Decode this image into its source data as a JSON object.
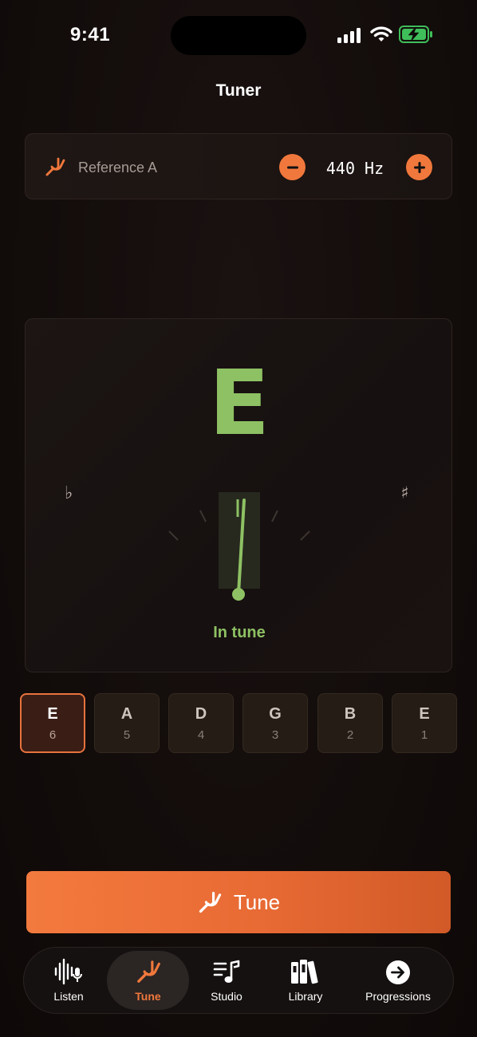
{
  "status_bar": {
    "time": "9:41"
  },
  "header": {
    "title": "Tuner"
  },
  "reference": {
    "label": "Reference A",
    "value": "440 Hz"
  },
  "tuner": {
    "note": "E",
    "flat_symbol": "♭",
    "sharp_symbol": "♯",
    "status": "In tune",
    "needle_cents": 0,
    "accent_color": "#8ec163"
  },
  "strings": [
    {
      "name": "E",
      "number": "6",
      "selected": true
    },
    {
      "name": "A",
      "number": "5",
      "selected": false
    },
    {
      "name": "D",
      "number": "4",
      "selected": false
    },
    {
      "name": "G",
      "number": "3",
      "selected": false
    },
    {
      "name": "B",
      "number": "2",
      "selected": false
    },
    {
      "name": "E",
      "number": "1",
      "selected": false
    }
  ],
  "actions": {
    "tune_label": "Tune"
  },
  "tabs": [
    {
      "label": "Listen",
      "icon": "waveform-mic-icon"
    },
    {
      "label": "Tune",
      "icon": "tuning-fork-icon",
      "active": true
    },
    {
      "label": "Studio",
      "icon": "music-list-icon"
    },
    {
      "label": "Library",
      "icon": "books-icon"
    },
    {
      "label": "Progressions",
      "icon": "arrow-right-circle-icon"
    }
  ],
  "colors": {
    "accent": "#f0783c",
    "in_tune": "#8ec163",
    "background": "#120c0b"
  }
}
